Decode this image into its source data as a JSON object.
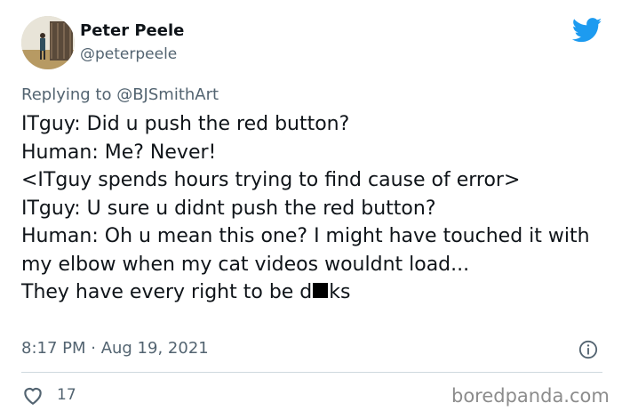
{
  "tweet": {
    "author_name": "Peter Peele",
    "author_handle": "@peterpeele",
    "replying_prefix": "Replying to ",
    "replying_to": "@BJSmithArt",
    "lines": [
      "ITguy: Did u push the red button?",
      "Human: Me? Never!",
      "<ITguy spends hours trying to find cause of error>",
      "ITguy: U sure u didnt push the red button?",
      "Human: Oh u mean this one? I might have touched it with my elbow when my cat videos wouldnt load..."
    ],
    "last_line_before": "They have every right to be d",
    "last_line_after": "ks",
    "timestamp": "8:17 PM · Aug 19, 2021",
    "like_count": "17"
  },
  "watermark": "boredpanda.com",
  "icons": {
    "brand": "twitter-bird-icon",
    "info": "info-icon",
    "like": "heart-icon"
  },
  "colors": {
    "twitter_blue": "#1d9bf0",
    "muted_text": "#536471",
    "primary_text": "#0f1419"
  }
}
